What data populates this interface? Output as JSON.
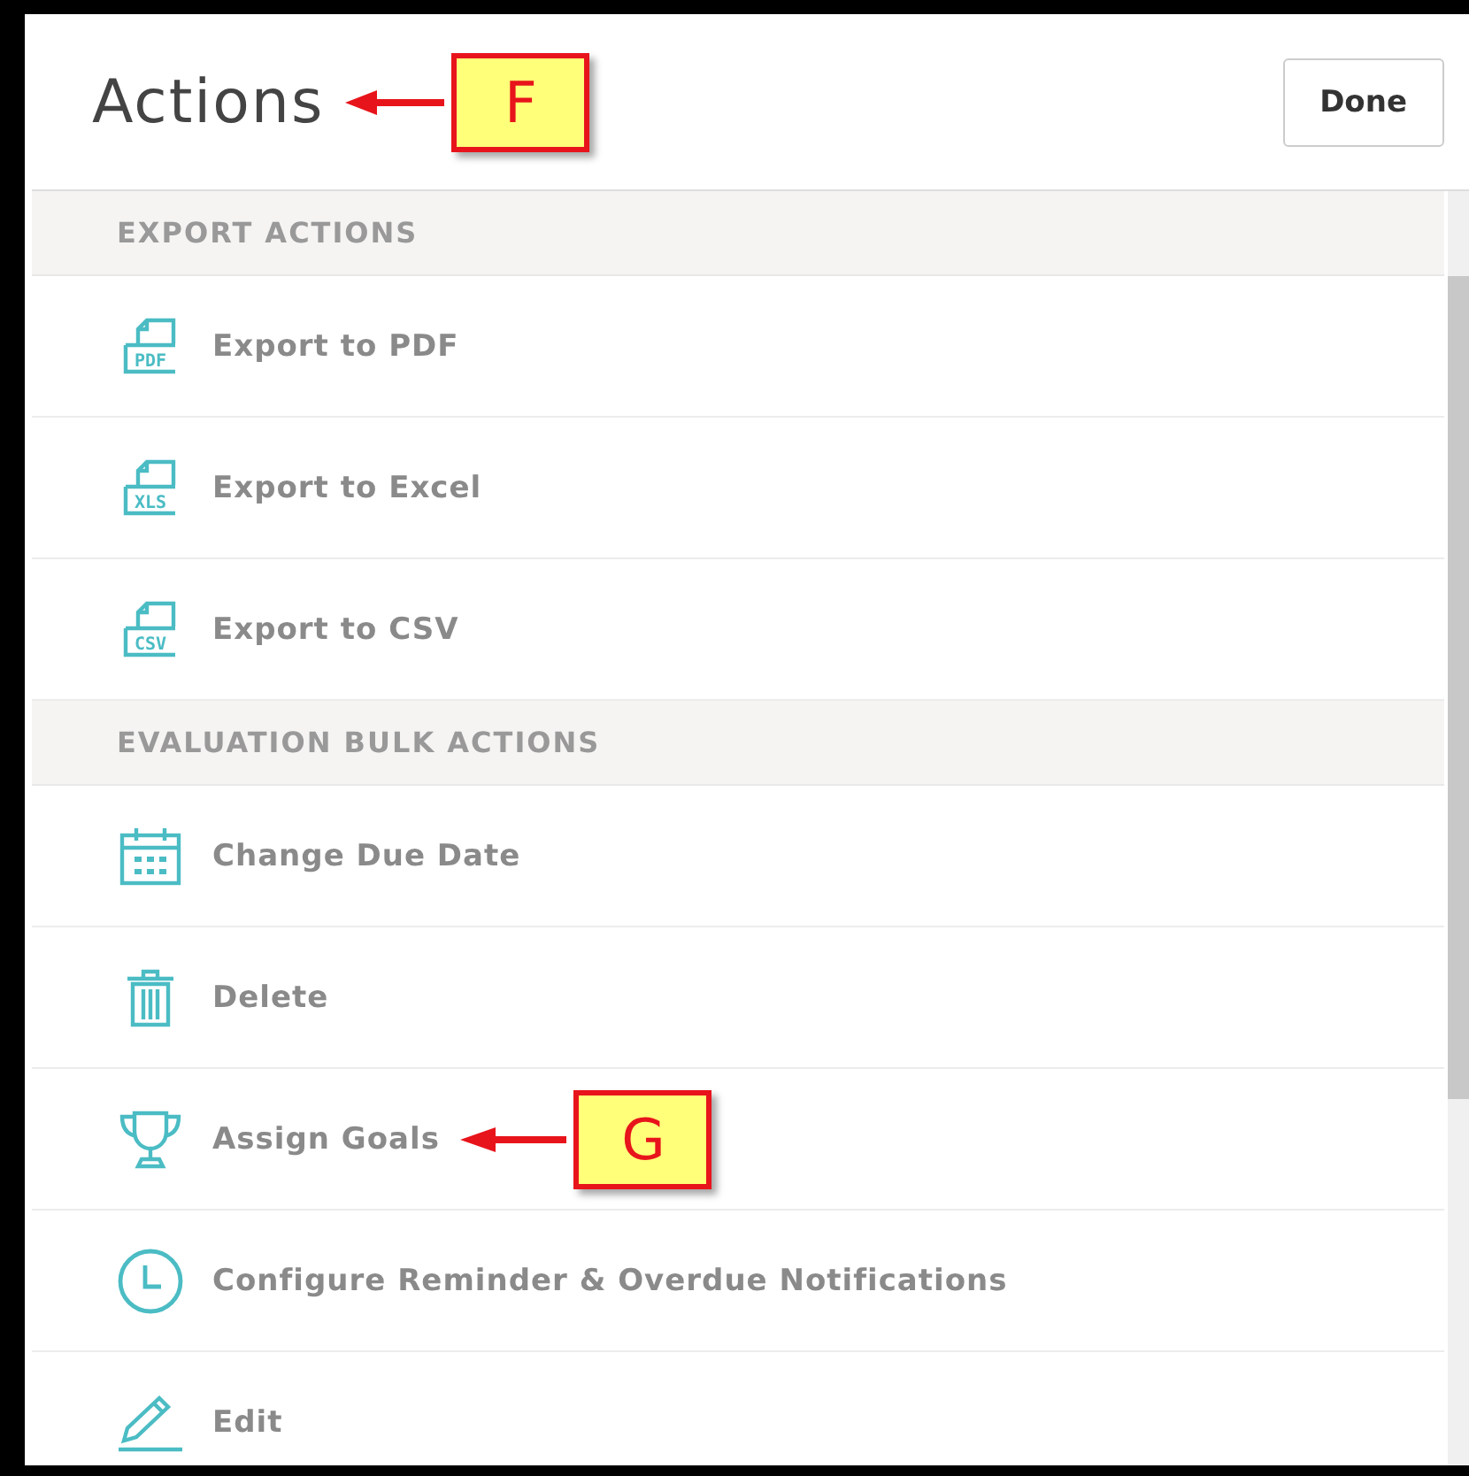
{
  "header": {
    "title": "Actions",
    "callout": "F",
    "done_button": "Done"
  },
  "sections": [
    {
      "title": "EXPORT ACTIONS",
      "items": [
        {
          "label": "Export to PDF",
          "kind": "file",
          "icon_text": "PDF"
        },
        {
          "label": "Export to Excel",
          "kind": "file",
          "icon_text": "XLS"
        },
        {
          "label": "Export to CSV",
          "kind": "file",
          "icon_text": "CSV"
        }
      ]
    },
    {
      "title": "EVALUATION BULK ACTIONS",
      "items": [
        {
          "label": "Change Due Date",
          "kind": "calendar"
        },
        {
          "label": "Delete",
          "kind": "trash"
        },
        {
          "label": "Assign Goals",
          "kind": "trophy",
          "callout": "G"
        },
        {
          "label": "Configure Reminder & Overdue Notifications",
          "kind": "clock"
        },
        {
          "label": "Edit",
          "kind": "pencil"
        }
      ]
    }
  ]
}
